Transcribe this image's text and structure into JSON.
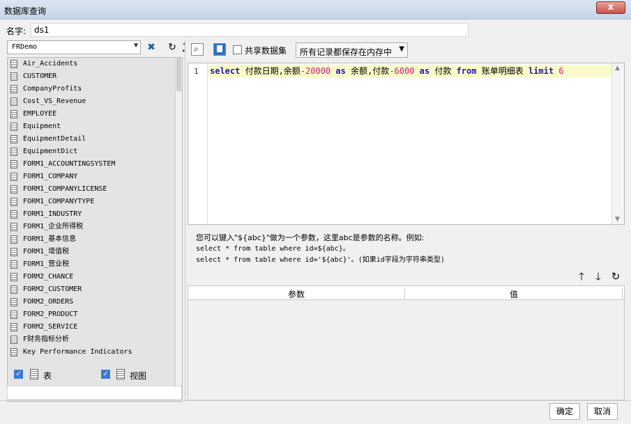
{
  "window": {
    "title": "数据库查询",
    "close_label": "x"
  },
  "name_field": {
    "label": "名字:",
    "value": "ds1"
  },
  "left_panel": {
    "connection": "FRDemo",
    "tables": [
      "Air_Accidents",
      "CUSTOMER",
      "CompanyProfits",
      "Cost_VS_Revenue",
      "EMPLOYEE",
      "Equipment",
      "EquipmentDetail",
      "EquipmentDict",
      "FORM1_ACCOUNTINGSYSTEM",
      "FORM1_COMPANY",
      "FORM1_COMPANYLICENSE",
      "FORM1_COMPANYTYPE",
      "FORM1_INDUSTRY",
      "FORM1_企业所得税",
      "FORM1_基本信息",
      "FORM1_增值税",
      "FORM1_营业税",
      "FORM2_CHANCE",
      "FORM2_CUSTOMER",
      "FORM2_ORDERS",
      "FORM2_PRODUCT",
      "FORM2_SERVICE",
      "F财务指标分析",
      "Key Performance Indicators"
    ],
    "show_tables_label": "表",
    "show_views_label": "视图"
  },
  "right_panel": {
    "share_label": "共享数据集",
    "storage_mode": "所有记录都保存在内存中",
    "line_number": "1",
    "sql": {
      "kw_select": "select",
      "t1": " 付款日期,余额",
      "n1": "-20000",
      "kw_as1": " as",
      "t2": " 余额,付款",
      "n2": "-6000",
      "kw_as2": " as",
      "t3": " 付款 ",
      "kw_from": "from",
      "t4": " 账单明细表 ",
      "kw_limit": "limit",
      "n3": " 6"
    },
    "hint_line1": "您可以键入\"${abc}\"做为一个参数，这里abc是参数的名称。例如:",
    "hint_line2": "select * from table where id=${abc}。",
    "hint_line3": "select * from table where id='${abc}'。(如果id字段为字符串类型)",
    "param_columns": [
      "参数",
      "值"
    ]
  },
  "buttons": {
    "ok": "确定",
    "cancel": "取消"
  },
  "colors": {
    "keyword": "#1a1ab8",
    "number": "#c81e8c",
    "highlight": "#fafac8"
  }
}
